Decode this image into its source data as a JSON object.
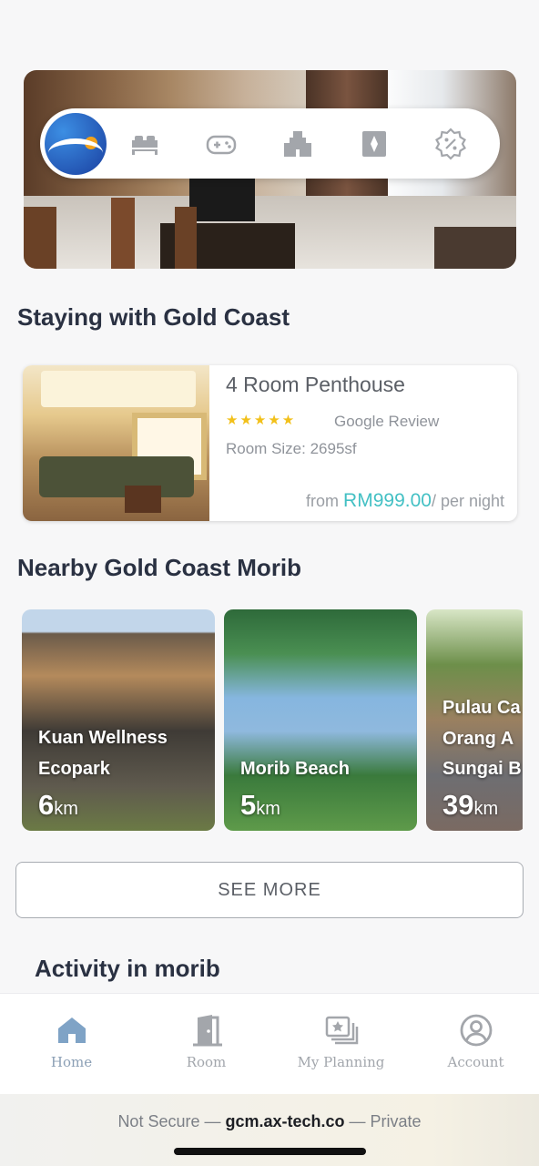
{
  "hero": {},
  "iconbar": {
    "items": [
      "logo",
      "bed-icon",
      "gamepad-icon",
      "building-icon",
      "card-icon",
      "discount-icon"
    ]
  },
  "section_staying": {
    "title": "Staying with Gold Coast"
  },
  "room_card": {
    "title": "4 Room Penthouse",
    "stars": "★★★★★",
    "review_label": "Google Review",
    "size": "Room Size: 2695sf",
    "price_prefix": "from ",
    "price_amount": "RM999.00",
    "price_suffix": "/ per night"
  },
  "section_nearby": {
    "title": "Nearby Gold Coast Morib"
  },
  "places": [
    {
      "line1": "Kuan Wellness",
      "line2": "Ecopark",
      "dist": "6",
      "unit": "km"
    },
    {
      "line1": "Morib Beach",
      "dist": "5",
      "unit": "km"
    },
    {
      "line1": "Pulau Ca",
      "line2": "Orang A",
      "line3": "Sungai B",
      "dist": "39",
      "unit": "km"
    }
  ],
  "see_more": "SEE MORE",
  "section_activity": {
    "title": "Activity in morib"
  },
  "tabbar": {
    "home": "Home",
    "room": "Room",
    "planning": "My Planning",
    "account": "Account"
  },
  "browser": {
    "security": "Not Secure — ",
    "host": "gcm.ax-tech.co",
    "mode": " — Private"
  },
  "colors": {
    "accent": "#43c0c4",
    "star": "#f2c019",
    "active_tab": "#7fa3c6"
  }
}
